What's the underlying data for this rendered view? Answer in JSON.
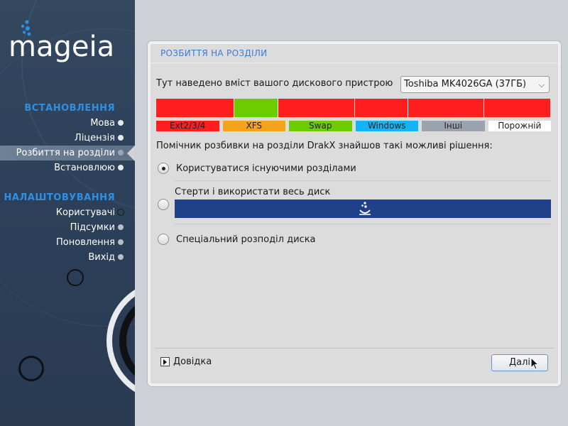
{
  "sidebar": {
    "logo_text": "mageia",
    "sections": [
      {
        "title": "ВСТАНОВЛЕННЯ",
        "items": [
          {
            "label": "Мова",
            "state": "done"
          },
          {
            "label": "Ліцензія",
            "state": "done"
          },
          {
            "label": "Розбиття на розділи",
            "state": "active"
          },
          {
            "label": "Встановлюю",
            "state": "pending"
          }
        ]
      },
      {
        "title": "НАЛАШТОВУВАННЯ",
        "items": [
          {
            "label": "Користувачі",
            "state": "pending"
          },
          {
            "label": "Підсумки",
            "state": "pending"
          },
          {
            "label": "Поновлення",
            "state": "pending"
          },
          {
            "label": "Вихід",
            "state": "pending"
          }
        ]
      }
    ]
  },
  "dialog": {
    "title": "РОЗБИТТЯ НА РОЗДІЛИ",
    "device_label": "Тут наведено вміст вашого дискового пристрою",
    "device_select": {
      "value": "Toshiba MK4026GA (37ГБ)",
      "icon": "chevron-down-icon"
    },
    "partitions": [
      {
        "type": "ext",
        "fraction": 0.198,
        "color": "#ff1e1e"
      },
      {
        "type": "swap",
        "fraction": 0.112,
        "color": "#6bcd00"
      },
      {
        "type": "ext",
        "fraction": 0.195,
        "color": "#ff1e1e"
      },
      {
        "type": "ext",
        "fraction": 0.135,
        "color": "#ff1e1e"
      },
      {
        "type": "ext",
        "fraction": 0.193,
        "color": "#ff1e1e"
      },
      {
        "type": "ext",
        "fraction": 0.167,
        "color": "#ff1e1e"
      }
    ],
    "legend": [
      {
        "label": "Ext2/3/4",
        "color": "#ff1e1e"
      },
      {
        "label": "XFS",
        "color": "#f4a41a"
      },
      {
        "label": "Swap",
        "color": "#6bcd00"
      },
      {
        "label": "Windows",
        "color": "#13b4f5"
      },
      {
        "label": "Інші",
        "color": "#9ba4ae"
      },
      {
        "label": "Порожній",
        "color": "#ffffff"
      }
    ],
    "helper_text": "Помічник розбивки на розділи DrakX знайшов такі можливі рішення:",
    "options": {
      "use_existing": {
        "label": "Користуватися існуючими розділами",
        "checked": true
      },
      "erase_disk": {
        "label": "Стерти і використати весь диск",
        "checked": false,
        "bar_color": "#20418a"
      },
      "custom": {
        "label": "Спеціальний розподіл диска",
        "checked": false
      }
    },
    "help_label": "Довідка",
    "next_label": "Далі"
  },
  "colors": {
    "accent": "#3a7bd5",
    "sidebar_section": "#2f8fe0",
    "sidebar_bg": "#2f435b"
  }
}
